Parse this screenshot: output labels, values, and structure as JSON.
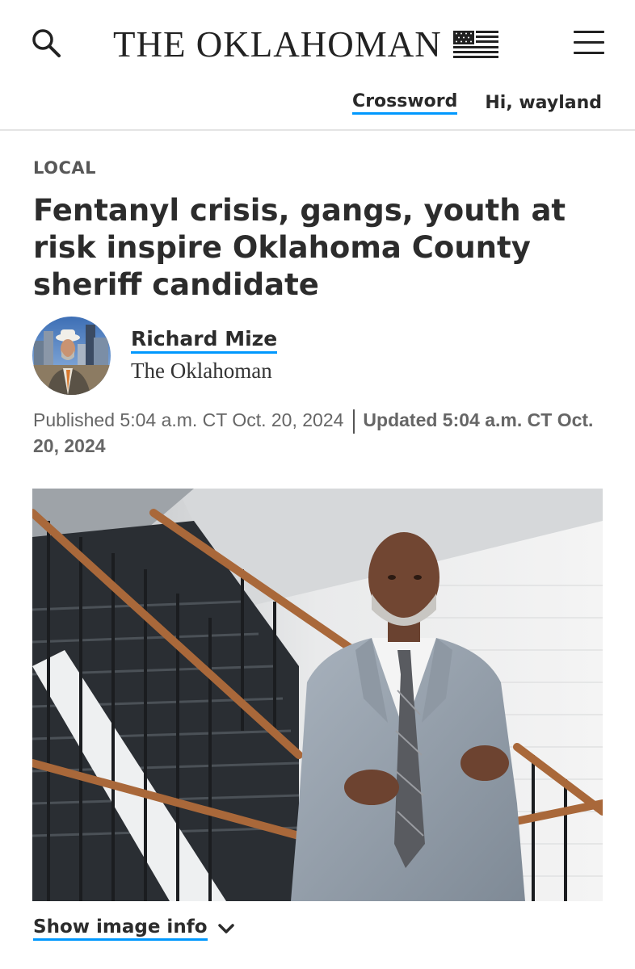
{
  "header": {
    "logo_text": "THE OKLAHOMAN",
    "crossword_label": "Crossword",
    "greeting": "Hi, wayland",
    "accent_color": "#0098fe"
  },
  "article": {
    "section": "LOCAL",
    "headline": "Fentanyl crisis, gangs, youth at risk inspire Oklahoma County sheriff candidate",
    "author": {
      "name": "Richard Mize",
      "organization": "The Oklahoman"
    },
    "published": "Published 5:04 a.m. CT Oct. 20, 2024",
    "updated": "Updated 5:04 a.m. CT Oct. 20, 2024",
    "image_info_label": "Show image info"
  },
  "icons": {
    "search": "search-icon",
    "menu": "hamburger-menu-icon",
    "flag": "flag-logo-icon",
    "chevron": "chevron-down-icon"
  }
}
